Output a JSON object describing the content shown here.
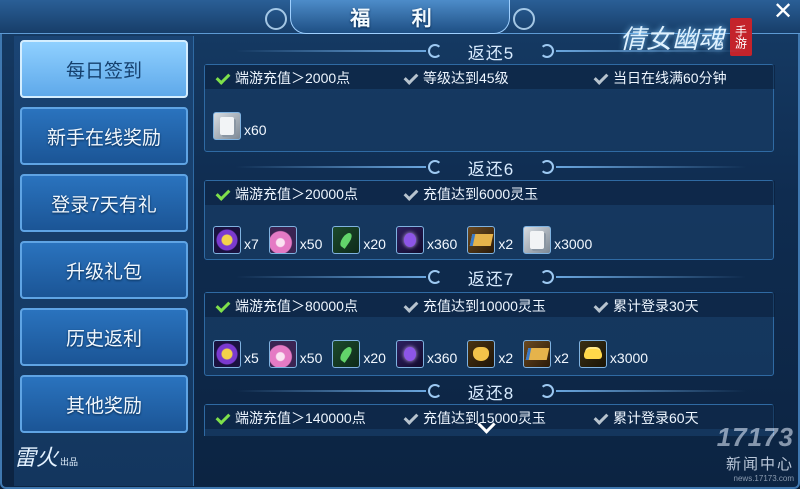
{
  "window": {
    "title": "福 利",
    "close_glyph": "✕"
  },
  "logo": {
    "main": "倩女幽魂",
    "stamp": "手游"
  },
  "sidebar": {
    "items": [
      {
        "label": "每日签到",
        "active": true
      },
      {
        "label": "新手在线奖励",
        "active": false
      },
      {
        "label": "登录7天有礼",
        "active": false
      },
      {
        "label": "升级礼包",
        "active": false
      },
      {
        "label": "历史返利",
        "active": false
      },
      {
        "label": "其他奖励",
        "active": false
      }
    ],
    "brand": "雷火",
    "brand_suffix": "出品"
  },
  "sections": [
    {
      "title": "返还5",
      "conditions": [
        {
          "text": "端游充值＞2000点",
          "met": true
        },
        {
          "text": "等级达到45级",
          "met": false
        },
        {
          "text": "当日在线满60分钟",
          "met": false
        }
      ],
      "rewards": [
        {
          "icon": "scroll-icon",
          "qty": "x60"
        }
      ]
    },
    {
      "title": "返还6",
      "conditions": [
        {
          "text": "端游充值＞20000点",
          "met": true
        },
        {
          "text": "充值达到6000灵玉",
          "met": false
        }
      ],
      "rewards": [
        {
          "icon": "orb-icon",
          "qty": "x7"
        },
        {
          "icon": "fan-icon",
          "qty": "x50"
        },
        {
          "icon": "herb-icon",
          "qty": "x20"
        },
        {
          "icon": "potion-icon",
          "qty": "x360"
        },
        {
          "icon": "map-icon",
          "qty": "x2"
        },
        {
          "icon": "scroll-icon",
          "qty": "x3000"
        }
      ]
    },
    {
      "title": "返还7",
      "conditions": [
        {
          "text": "端游充值＞80000点",
          "met": true
        },
        {
          "text": "充值达到10000灵玉",
          "met": false
        },
        {
          "text": "累计登录30天",
          "met": false
        }
      ],
      "rewards": [
        {
          "icon": "orb-icon",
          "qty": "x5"
        },
        {
          "icon": "fan-icon",
          "qty": "x50"
        },
        {
          "icon": "herb-icon",
          "qty": "x20"
        },
        {
          "icon": "potion-icon",
          "qty": "x360"
        },
        {
          "icon": "pouch-icon",
          "qty": "x2"
        },
        {
          "icon": "map-icon",
          "qty": "x2"
        },
        {
          "icon": "gold-icon",
          "qty": "x3000"
        }
      ]
    },
    {
      "title": "返还8",
      "conditions": [
        {
          "text": "端游充值＞140000点",
          "met": true
        },
        {
          "text": "充值达到15000灵玉",
          "met": false
        },
        {
          "text": "累计登录60天",
          "met": false
        }
      ],
      "rewards": []
    }
  ],
  "watermark": {
    "logo": "17173",
    "text": "新闻中心",
    "url": "news.17173.com"
  }
}
